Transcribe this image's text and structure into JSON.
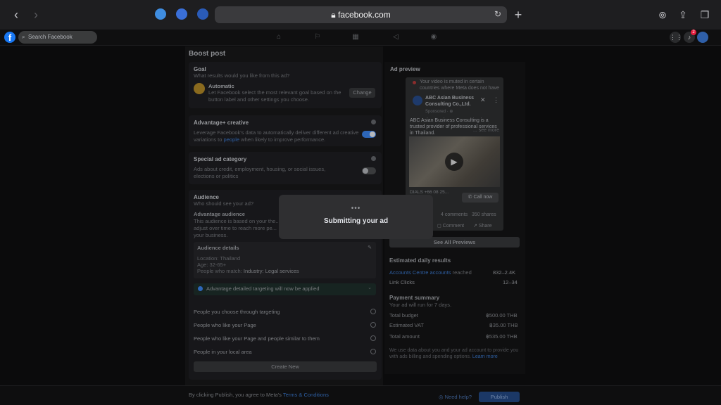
{
  "browser": {
    "url": "facebook.com"
  },
  "topbar": {
    "search_placeholder": "Search Facebook",
    "notification_count": "2"
  },
  "page": {
    "title": "Boost post"
  },
  "goal": {
    "heading": "Goal",
    "subheading": "What results would you like from this ad?",
    "option_title": "Automatic",
    "option_desc": "Let Facebook select the most relevant goal based on the button label and other settings you choose.",
    "change_label": "Change"
  },
  "advantage_creative": {
    "heading": "Advantage+ creative",
    "desc_pre": "Leverage Facebook's data to automatically deliver different ad creative variations to ",
    "desc_link": "people",
    "desc_post": " when likely to improve performance."
  },
  "special_category": {
    "heading": "Special ad category",
    "desc": "Ads about credit, employment, housing, or social issues, elections or politics"
  },
  "audience": {
    "heading": "Audience",
    "subheading": "Who should see your ad?",
    "advantage_title": "Advantage audience",
    "advantage_desc": "This audience is based on your the... adjust over time to reach more pe... your business.",
    "details_title": "Audience details",
    "location": "Location: Thailand",
    "age": "Age: 32-65+",
    "people_match_pre": "People who match: ",
    "people_match_value": "Industry: Legal services",
    "banner": "Advantage detailed targeting will now be applied",
    "options": [
      "People you choose through targeting",
      "People who like your Page",
      "People who like your Page and people similar to them",
      "People in your local area"
    ],
    "create_new": "Create New"
  },
  "ad_preview": {
    "heading": "Ad preview",
    "muted_notice": "Your video is muted in certain countries where Meta does not have music rights",
    "page_name": "ABC Asian Business Consulting Co.,Ltd.",
    "sponsored": "Sponsored · ⊕",
    "body": "ABC Asian Business Consulting is a trusted provider of professional services in Thailand.",
    "see_more": "... see more",
    "cta_text_line1": "DIALS +66 08 25...",
    "cta_text_line2": "...ess",
    "call_now": "Call now",
    "comments": "4 comments",
    "shares": "350 shares",
    "comment_btn": "Comment",
    "share_btn": "Share",
    "see_all": "See All Previews"
  },
  "estimates": {
    "heading": "Estimated daily results",
    "reach_label": "Accounts Centre accounts",
    "reach_suffix": "reached",
    "reach_value": "832–2.4K",
    "clicks_label": "Link Clicks",
    "clicks_value": "12–34"
  },
  "payment": {
    "heading": "Payment summary",
    "subheading": "Your ad will run for 7 days.",
    "rows": [
      {
        "label": "Total budget",
        "value": "฿500.00 THB"
      },
      {
        "label": "Estimated VAT",
        "value": "฿35.00 THB"
      },
      {
        "label": "Total amount",
        "value": "฿535.00 THB"
      }
    ],
    "disclaimer": "We use data about you and your ad account to provide you with ads billing and spending options.",
    "learn_more": "Learn more"
  },
  "modal": {
    "text": "Submitting your ad"
  },
  "footer": {
    "agree_pre": "By clicking Publish, you agree to Meta's ",
    "agree_link": "Terms & Conditions",
    "need_help": "Need help?",
    "publish": "Publish"
  },
  "colors": {
    "brand": "#1877f2",
    "toggle_on": "#2d66b8",
    "notification": "#e41e3f"
  },
  "icons": [
    "back-icon",
    "forward-icon",
    "reload-icon",
    "lock-icon",
    "plus-icon",
    "download-icon",
    "share-icon",
    "tabs-icon",
    "grid-icon",
    "bell-icon",
    "home-icon",
    "flag-icon",
    "video-icon",
    "megaphone-icon",
    "marketplace-icon",
    "info-icon",
    "play-icon",
    "phone-icon"
  ]
}
